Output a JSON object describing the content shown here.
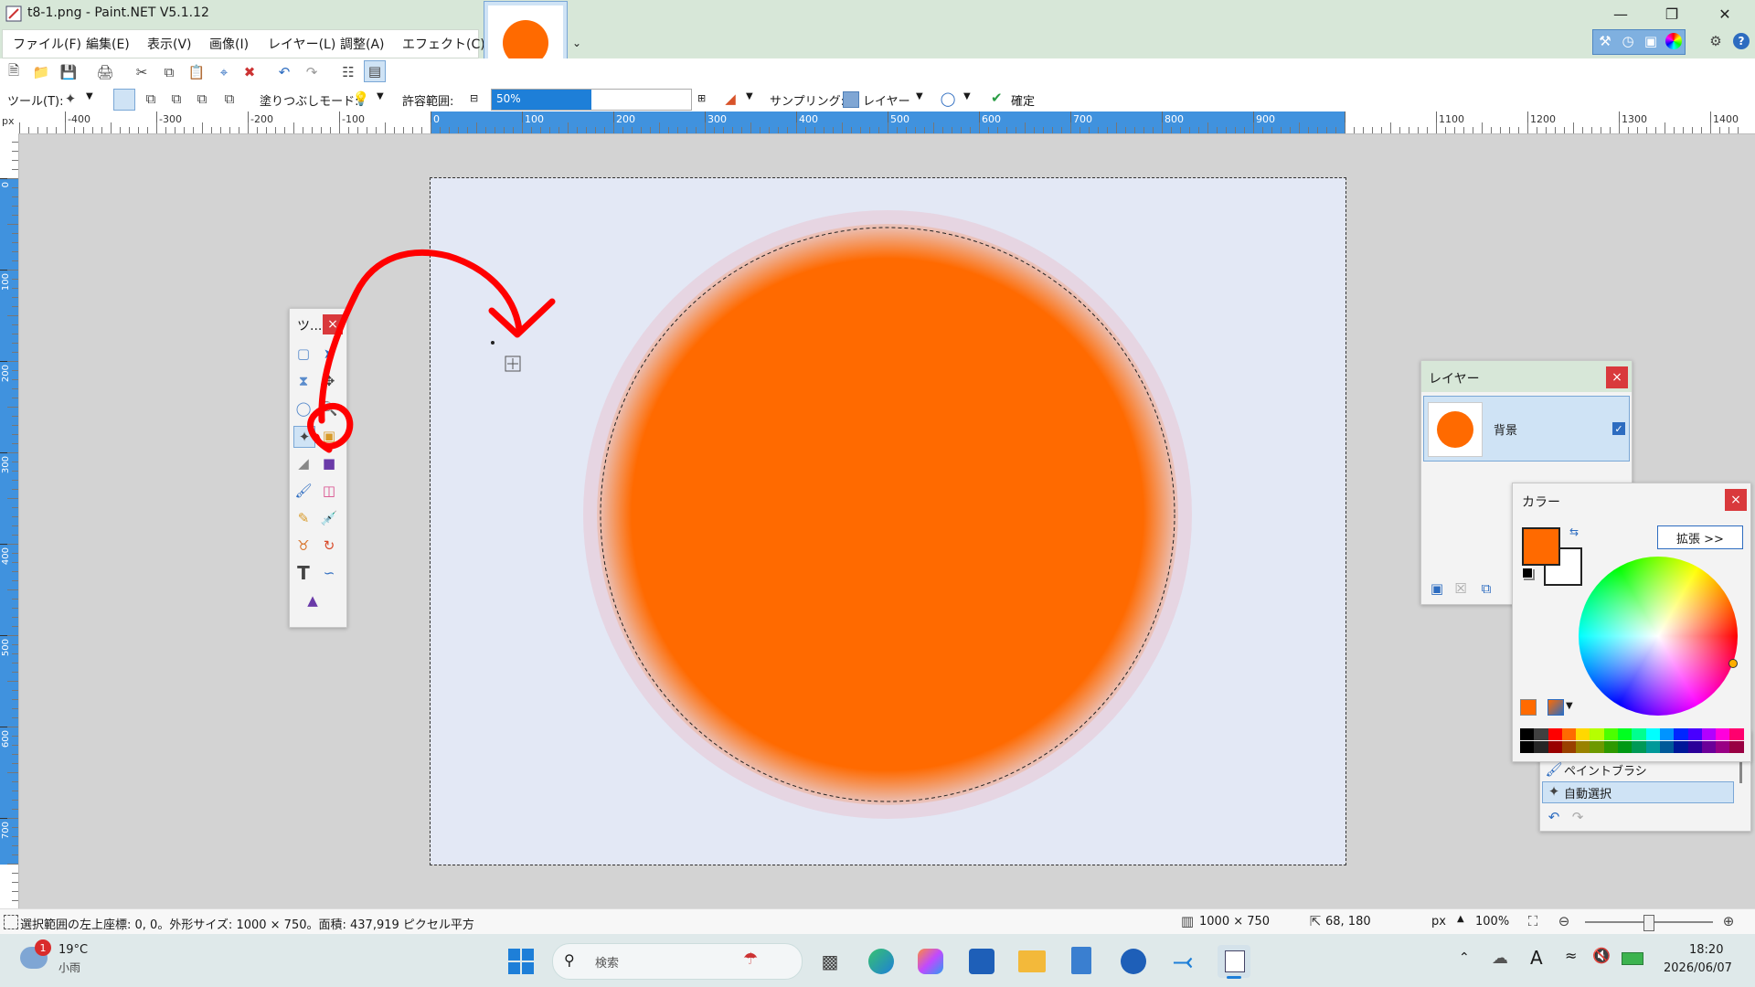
{
  "window": {
    "title": "t8-1.png - Paint.NET V5.1.12",
    "tab_thumbnail_color": "#ff6a00"
  },
  "menu": {
    "items": [
      "ファイル(F)",
      "編集(E)",
      "表示(V)",
      "画像(I)",
      "レイヤー(L)",
      "調整(A)",
      "エフェクト(C)"
    ]
  },
  "toolbar": {
    "tool_label": "ツール(T):",
    "fill_mode_label": "塗りつぶしモード:",
    "tolerance_label": "許容範囲:",
    "tolerance_value": "50%",
    "tolerance_fraction": 0.5,
    "sampling_label": "サンプリング:",
    "sampling_value": "レイヤー",
    "confirm_label": "確定"
  },
  "ruler": {
    "unit": "px",
    "h_ticks": [
      "-400",
      "-300",
      "-200",
      "-100",
      "0",
      "100",
      "200",
      "300",
      "400",
      "500",
      "600",
      "700",
      "800",
      "900",
      "1000",
      "1100",
      "1200",
      "1300",
      "1400"
    ],
    "v_ticks": [
      "0",
      "100",
      "200",
      "300",
      "400",
      "500",
      "600",
      "700"
    ]
  },
  "tools_panel": {
    "title": "ツ...",
    "close": "×"
  },
  "layers_panel": {
    "title": "レイヤー",
    "close": "×",
    "layer_name": "背景",
    "layer_visible": true
  },
  "colors_panel": {
    "title": "カラー",
    "close": "×",
    "expand_label": "拡張 >>",
    "primary_color": "#ff6a00",
    "secondary_color": "#ffffff",
    "palette": [
      "#000000",
      "#404040",
      "#ff0000",
      "#ff6a00",
      "#ffd800",
      "#b6ff00",
      "#4cff00",
      "#00ff21",
      "#00ff90",
      "#00ffff",
      "#0094ff",
      "#0026ff",
      "#4800ff",
      "#b200ff",
      "#ff00dc",
      "#ff006e"
    ]
  },
  "history_panel": {
    "items": [
      "ペイントブラシ",
      "自動選択"
    ]
  },
  "status": {
    "selection_info": "選択範囲の左上座標: 0, 0。外形サイズ: 1000 × 750。面積: 437,919 ピクセル平方",
    "image_size": "1000 × 750",
    "cursor_pos": "68, 180",
    "unit": "px",
    "zoom": "100%"
  },
  "taskbar": {
    "weather_temp": "19°C",
    "weather_desc": "小雨",
    "weather_badge": "1",
    "search_placeholder": "検索",
    "time": "18:20",
    "date": "2026/06/07"
  }
}
